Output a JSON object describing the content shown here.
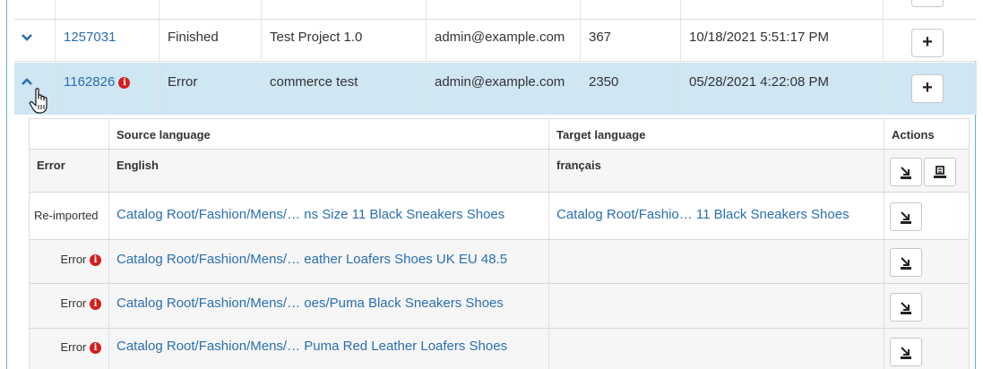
{
  "jobs": [
    {
      "id": "1257031",
      "status": "Finished",
      "project": "Test Project 1.0",
      "user": "admin@example.com",
      "count": "367",
      "date": "10/18/2021 5:51:17 PM",
      "expanded": false
    },
    {
      "id": "1162826",
      "status": "Error",
      "project": "commerce test",
      "user": "admin@example.com",
      "count": "2350",
      "date": "05/28/2021 4:22:08 PM",
      "expanded": true
    }
  ],
  "detail": {
    "headers": {
      "status": "",
      "source": "Source language",
      "target": "Target language",
      "actions": "Actions"
    },
    "lang_row": {
      "status": "Error",
      "source": "English",
      "target": "français"
    },
    "items": [
      {
        "status": "Re-imported",
        "source": "Catalog Root/Fashion/Mens/… ns Size 11 Black Sneakers Shoes",
        "target": "Catalog Root/Fashio… 11 Black Sneakers Shoes"
      },
      {
        "status": "Error",
        "source": "Catalog Root/Fashion/Mens/… eather Loafers Shoes UK EU 48.5",
        "target": ""
      },
      {
        "status": "Error",
        "source": "Catalog Root/Fashion/Mens/… oes/Puma Black Sneakers Shoes",
        "target": ""
      },
      {
        "status": "Error",
        "source": "Catalog Root/Fashion/Mens/… Puma Red Leather Loafers Shoes",
        "target": ""
      }
    ]
  },
  "icons": {
    "expand": "chevron-down-icon",
    "collapse": "chevron-up-icon",
    "info": "info-circle-icon",
    "import": "import-icon",
    "export": "export-icon",
    "add": "plus-icon"
  },
  "colors": {
    "link": "#2a6fb0",
    "error": "#d21f1f",
    "selected_row": "#cfe6f3",
    "frame": "#5bb8c4"
  }
}
